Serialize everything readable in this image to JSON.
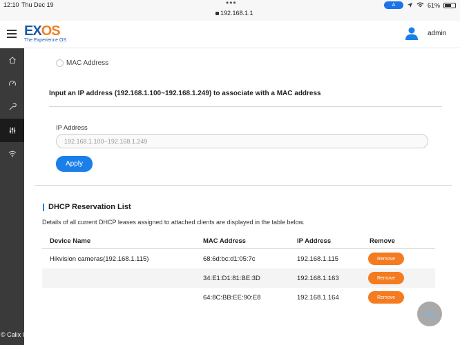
{
  "status_bar": {
    "time": "12:10",
    "date": "Thu Dec 19",
    "url": "192.168.1.1",
    "battery": "61%"
  },
  "header": {
    "logo_main": "EX",
    "logo_accent": "OS",
    "logo_tagline": "The Experience OS",
    "username": "admin"
  },
  "sidebar": {
    "items": [
      {
        "icon": "home-icon"
      },
      {
        "icon": "gauge-icon"
      },
      {
        "icon": "wrench-icon"
      },
      {
        "icon": "sliders-icon",
        "active": true
      },
      {
        "icon": "wifi-icon"
      }
    ],
    "footer": "© Calix Inc."
  },
  "form": {
    "mac_option_label": "MAC Address",
    "instruction": "Input an IP address (192.168.1.100~192.168.1.249) to associate with a MAC address",
    "ip_label": "IP Address",
    "ip_placeholder": "192.168.1.100~192.168.1.249",
    "apply_label": "Apply"
  },
  "reservations": {
    "title": "DHCP Reservation List",
    "description": "Details of all current DHCP leases assigned to attached clients are displayed in the table below.",
    "columns": [
      "Device Name",
      "MAC Address",
      "IP Address",
      "Remove"
    ],
    "rows": [
      {
        "device": "Hikvision cameras(192.168.1.115)",
        "mac": "68:6d:bc:d1:05:7c",
        "ip": "192.168.1.115",
        "remove": "Remove"
      },
      {
        "device": "",
        "mac": "34:E1:D1:81:BE:3D",
        "ip": "192.168.1.163",
        "remove": "Remove"
      },
      {
        "device": "",
        "mac": "64:8C:BB:EE:90:E8",
        "ip": "192.168.1.164",
        "remove": "Remove"
      }
    ]
  },
  "colors": {
    "accent_blue": "#1a7fe8",
    "remove_orange": "#f47b20",
    "sidebar_bg": "#3a3a3a",
    "logo_blue": "#1d5aa8",
    "logo_orange": "#f08024"
  }
}
